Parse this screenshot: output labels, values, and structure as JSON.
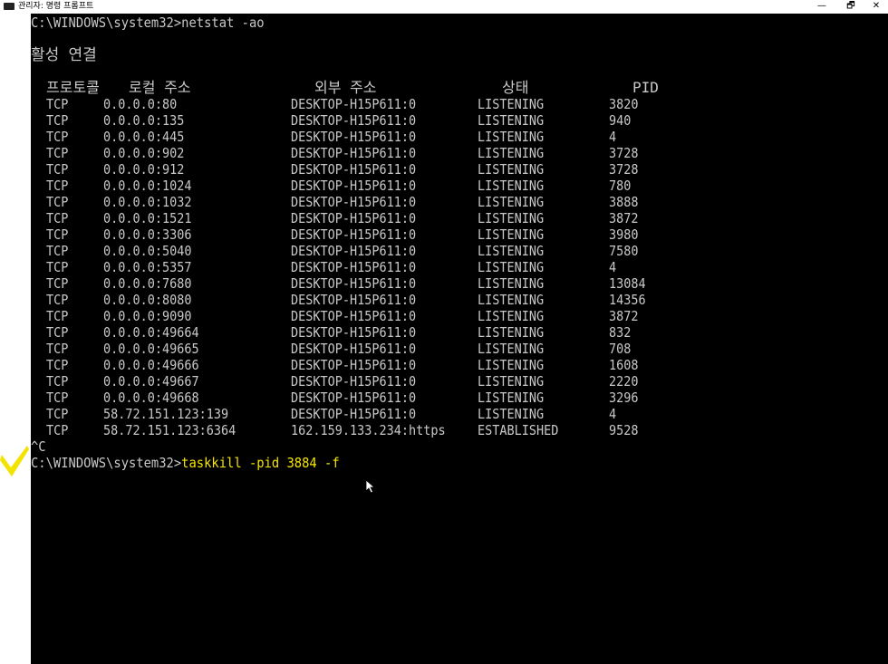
{
  "window": {
    "title": "관리자: 명령 프롬프트",
    "minimize_label": "—",
    "maximize_label": "🗗",
    "close_label": "✕"
  },
  "console": {
    "command1": "C:\\WINDOWS\\system32>netstat -ao",
    "section_heading": "활성 연결",
    "headers": {
      "proto": "프로토콜",
      "local": "로컬 주소",
      "foreign": "외부 주소",
      "state": "상태",
      "pid": "PID"
    },
    "rows": [
      {
        "proto": "TCP",
        "local": "0.0.0.0:80",
        "foreign": "DESKTOP-H15P611:0",
        "state": "LISTENING",
        "pid": "3820"
      },
      {
        "proto": "TCP",
        "local": "0.0.0.0:135",
        "foreign": "DESKTOP-H15P611:0",
        "state": "LISTENING",
        "pid": "940"
      },
      {
        "proto": "TCP",
        "local": "0.0.0.0:445",
        "foreign": "DESKTOP-H15P611:0",
        "state": "LISTENING",
        "pid": "4"
      },
      {
        "proto": "TCP",
        "local": "0.0.0.0:902",
        "foreign": "DESKTOP-H15P611:0",
        "state": "LISTENING",
        "pid": "3728"
      },
      {
        "proto": "TCP",
        "local": "0.0.0.0:912",
        "foreign": "DESKTOP-H15P611:0",
        "state": "LISTENING",
        "pid": "3728"
      },
      {
        "proto": "TCP",
        "local": "0.0.0.0:1024",
        "foreign": "DESKTOP-H15P611:0",
        "state": "LISTENING",
        "pid": "780"
      },
      {
        "proto": "TCP",
        "local": "0.0.0.0:1032",
        "foreign": "DESKTOP-H15P611:0",
        "state": "LISTENING",
        "pid": "3888"
      },
      {
        "proto": "TCP",
        "local": "0.0.0.0:1521",
        "foreign": "DESKTOP-H15P611:0",
        "state": "LISTENING",
        "pid": "3872"
      },
      {
        "proto": "TCP",
        "local": "0.0.0.0:3306",
        "foreign": "DESKTOP-H15P611:0",
        "state": "LISTENING",
        "pid": "3980"
      },
      {
        "proto": "TCP",
        "local": "0.0.0.0:5040",
        "foreign": "DESKTOP-H15P611:0",
        "state": "LISTENING",
        "pid": "7580"
      },
      {
        "proto": "TCP",
        "local": "0.0.0.0:5357",
        "foreign": "DESKTOP-H15P611:0",
        "state": "LISTENING",
        "pid": "4"
      },
      {
        "proto": "TCP",
        "local": "0.0.0.0:7680",
        "foreign": "DESKTOP-H15P611:0",
        "state": "LISTENING",
        "pid": "13084"
      },
      {
        "proto": "TCP",
        "local": "0.0.0.0:8080",
        "foreign": "DESKTOP-H15P611:0",
        "state": "LISTENING",
        "pid": "14356"
      },
      {
        "proto": "TCP",
        "local": "0.0.0.0:9090",
        "foreign": "DESKTOP-H15P611:0",
        "state": "LISTENING",
        "pid": "3872"
      },
      {
        "proto": "TCP",
        "local": "0.0.0.0:49664",
        "foreign": "DESKTOP-H15P611:0",
        "state": "LISTENING",
        "pid": "832"
      },
      {
        "proto": "TCP",
        "local": "0.0.0.0:49665",
        "foreign": "DESKTOP-H15P611:0",
        "state": "LISTENING",
        "pid": "708"
      },
      {
        "proto": "TCP",
        "local": "0.0.0.0:49666",
        "foreign": "DESKTOP-H15P611:0",
        "state": "LISTENING",
        "pid": "1608"
      },
      {
        "proto": "TCP",
        "local": "0.0.0.0:49667",
        "foreign": "DESKTOP-H15P611:0",
        "state": "LISTENING",
        "pid": "2220"
      },
      {
        "proto": "TCP",
        "local": "0.0.0.0:49668",
        "foreign": "DESKTOP-H15P611:0",
        "state": "LISTENING",
        "pid": "3296"
      },
      {
        "proto": "TCP",
        "local": "58.72.151.123:139",
        "foreign": "DESKTOP-H15P611:0",
        "state": "LISTENING",
        "pid": "4"
      },
      {
        "proto": "TCP",
        "local": "58.72.151.123:6364",
        "foreign": "162.159.133.234:https",
        "state": "ESTABLISHED",
        "pid": "9528"
      }
    ],
    "interrupt": "^C",
    "prompt2": "C:\\WINDOWS\\system32>",
    "command2": "taskkill -pid 3884 -f"
  },
  "colors": {
    "console_bg": "#000000",
    "console_text": "#c8c8c8",
    "typed_command": "#f5e500",
    "annotation_checkmark": "#f2e400"
  },
  "icons": [
    "console-app-icon",
    "checkmark-icon",
    "mouse-cursor-icon"
  ]
}
